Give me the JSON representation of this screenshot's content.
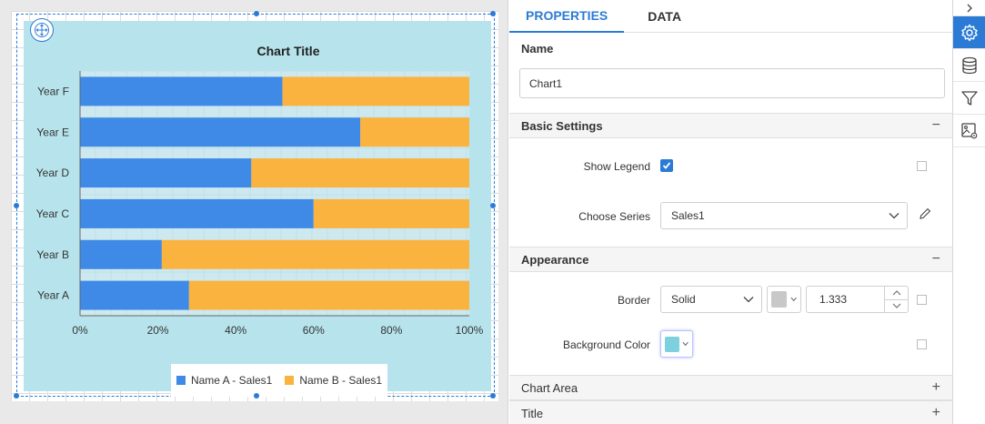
{
  "chart_data": {
    "type": "bar",
    "orientation": "horizontal",
    "stacked": "100%",
    "title": "Chart Title",
    "categories": [
      "Year A",
      "Year B",
      "Year C",
      "Year D",
      "Year E",
      "Year F"
    ],
    "series": [
      {
        "name": "Name A - Sales1",
        "color": "#3f8ae6",
        "values": [
          28,
          21,
          60,
          44,
          72,
          52
        ]
      },
      {
        "name": "Name B - Sales1",
        "color": "#fbb33f",
        "values": [
          72,
          79,
          40,
          56,
          28,
          48
        ]
      }
    ],
    "xticks": [
      "0%",
      "20%",
      "40%",
      "60%",
      "80%",
      "100%"
    ],
    "xlim": [
      0,
      100
    ],
    "legend": "bottom",
    "grid": true,
    "background": "#b7e4ec",
    "plot_background": "#cde9ef"
  },
  "panel": {
    "tabs": [
      {
        "label": "PROPERTIES"
      },
      {
        "label": "DATA"
      }
    ],
    "name_label": "Name",
    "name_value": "Chart1",
    "sections": {
      "basic": {
        "title": "Basic Settings",
        "toggle": "−"
      },
      "appearance": {
        "title": "Appearance",
        "toggle": "−"
      },
      "chart_area": {
        "title": "Chart Area",
        "toggle": "+"
      },
      "title": {
        "title": "Title",
        "toggle": "+"
      }
    },
    "show_legend_label": "Show Legend",
    "choose_series_label": "Choose Series",
    "choose_series_value": "Sales1",
    "border_label": "Border",
    "border_style_value": "Solid",
    "border_color": "#c8c8c8",
    "border_width_value": "1.333",
    "background_color_label": "Background Color",
    "background_color": "#7dd0dd"
  },
  "sidebar": {
    "icons": [
      "chevron-right-icon",
      "gear-icon",
      "database-icon",
      "filter-icon",
      "image-settings-icon"
    ],
    "accent": "#2b7bd6"
  }
}
